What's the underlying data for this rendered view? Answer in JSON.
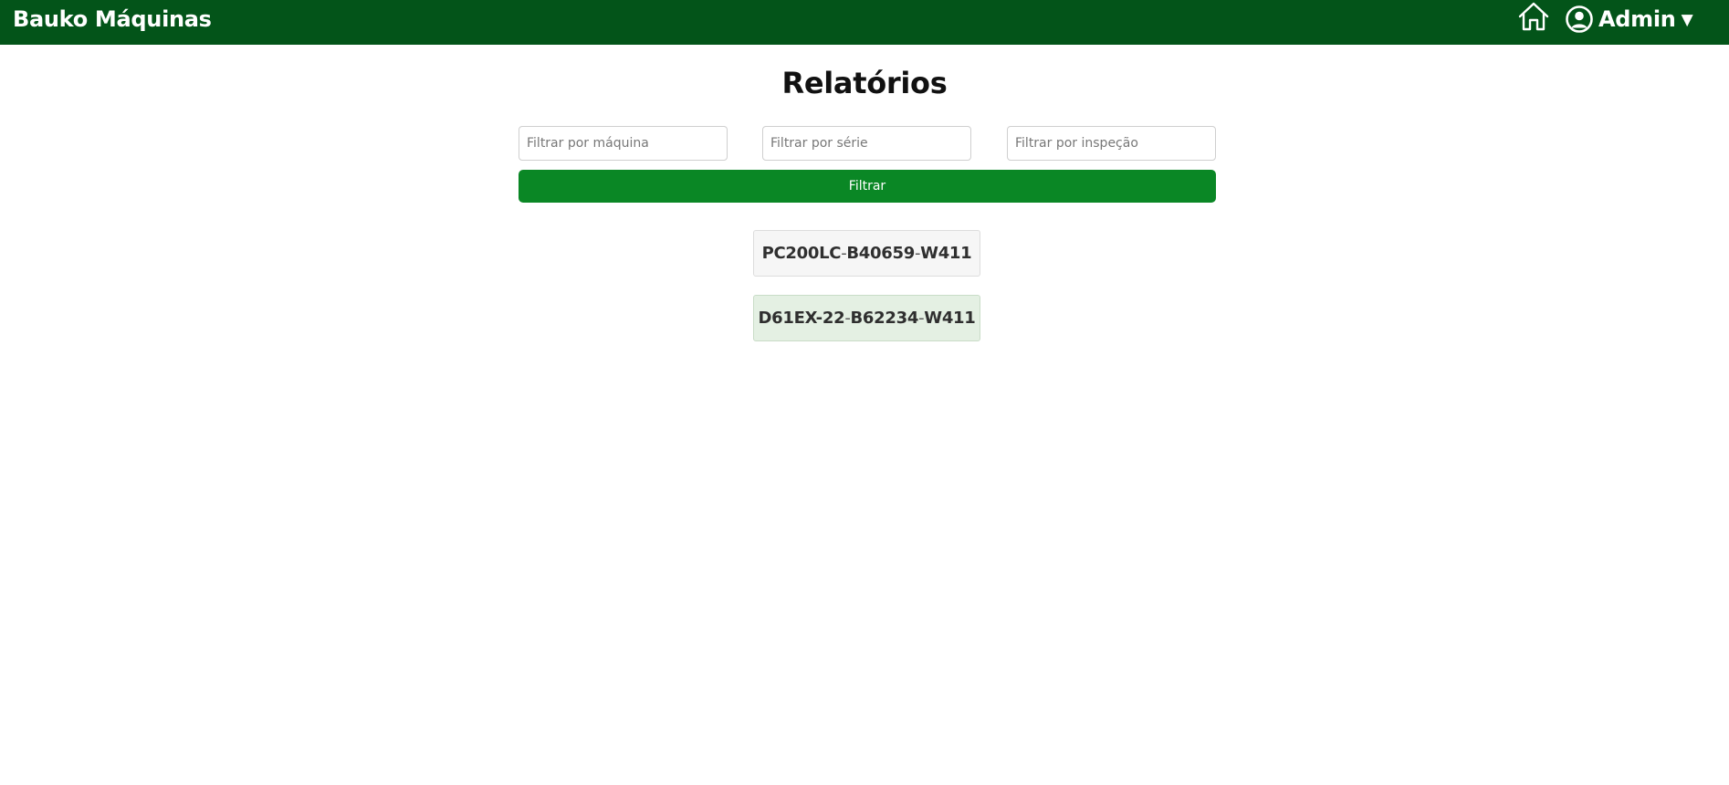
{
  "navbar": {
    "brand": "Bauko Máquinas",
    "user_name": "Admin",
    "caret": "▼",
    "icons": {
      "home": "home-icon",
      "user": "user-circle-icon"
    },
    "background_color": "#035419"
  },
  "main": {
    "title": "Relatórios",
    "filters": {
      "machine_placeholder": "Filtrar por máquina",
      "serial_placeholder": "Filtrar por série",
      "inspection_placeholder": "Filtrar por inspeção",
      "machine_value": "",
      "serial_value": "",
      "inspection_value": ""
    },
    "filter_button_label": "Filtrar",
    "filter_button_color": "#0a8725",
    "reports": [
      {
        "machine": "PC200LC",
        "serial": "B40659",
        "inspection": "W411",
        "separator": "-"
      },
      {
        "machine": "D61EX-22",
        "serial": "B62234",
        "inspection": "W411",
        "separator": "-"
      }
    ]
  }
}
